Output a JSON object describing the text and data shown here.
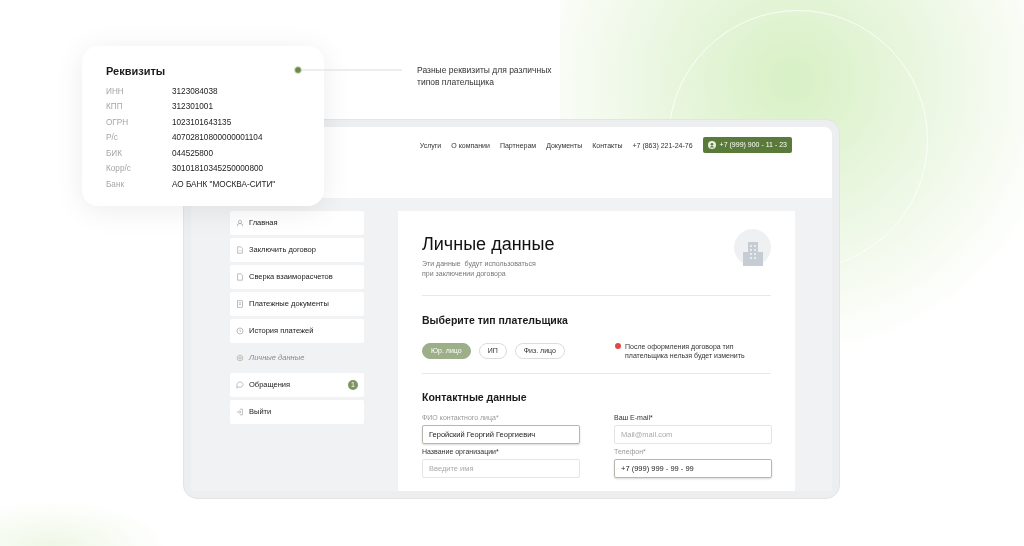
{
  "requisites": {
    "title": "Реквизиты",
    "rows": [
      {
        "label": "ИНН",
        "value": "3123084038"
      },
      {
        "label": "КПП",
        "value": "312301001"
      },
      {
        "label": "ОГРН",
        "value": "1023101643135"
      },
      {
        "label": "Р/с",
        "value": "40702810800000001104"
      },
      {
        "label": "БИК",
        "value": "044525800"
      },
      {
        "label": "Корр/с",
        "value": "30101810345250000800"
      },
      {
        "label": "Банк",
        "value": "АО БАНК \"МОСКВА-СИТИ\""
      }
    ]
  },
  "callout": "Разные реквизиты для различных типов плательщика",
  "header": {
    "nav": [
      "Услуги",
      "О компании",
      "Партнерам",
      "Документы",
      "Контакты"
    ],
    "phone": "+7 (863) 221-24-76",
    "account_button": "+7 (999) 900 - 11 - 23"
  },
  "sidebar": {
    "items": [
      {
        "label": "Главная",
        "selected": false
      },
      {
        "label": "Заключить договор",
        "selected": false
      },
      {
        "label": "Сверка взаиморасчетов",
        "selected": false
      },
      {
        "label": "Платежные документы",
        "selected": false
      },
      {
        "label": "История платежей",
        "selected": false
      },
      {
        "label": "Личные данные",
        "selected": true
      },
      {
        "label": "Обращения",
        "selected": false,
        "badge": "1"
      },
      {
        "label": "Выйти",
        "selected": false
      }
    ]
  },
  "content": {
    "title": "Личные данные",
    "subtitle": "Эти данные  будут использоваться\nпри заключении договора",
    "payer_type": {
      "title": "Выберите тип плательщика",
      "options": [
        {
          "label": "Юр. лицо",
          "selected": true
        },
        {
          "label": "ИП",
          "selected": false
        },
        {
          "label": "Физ. лицо",
          "selected": false
        }
      ],
      "warning": "После оформления договора тип\nплательщика нельзя будет изменить"
    },
    "contacts": {
      "title": "Контактные данные",
      "fields": [
        {
          "label": "ФИО контактного лица*",
          "value": "Геройский Георгий Георгиевич"
        },
        {
          "label": "Ваш E-mail*",
          "placeholder": "Mail@mail.com"
        },
        {
          "label": "Название организации*",
          "placeholder": "Введите имя"
        },
        {
          "label": "Телефон*",
          "value": "+7 (999) 999 - 99 - 99"
        }
      ]
    }
  }
}
